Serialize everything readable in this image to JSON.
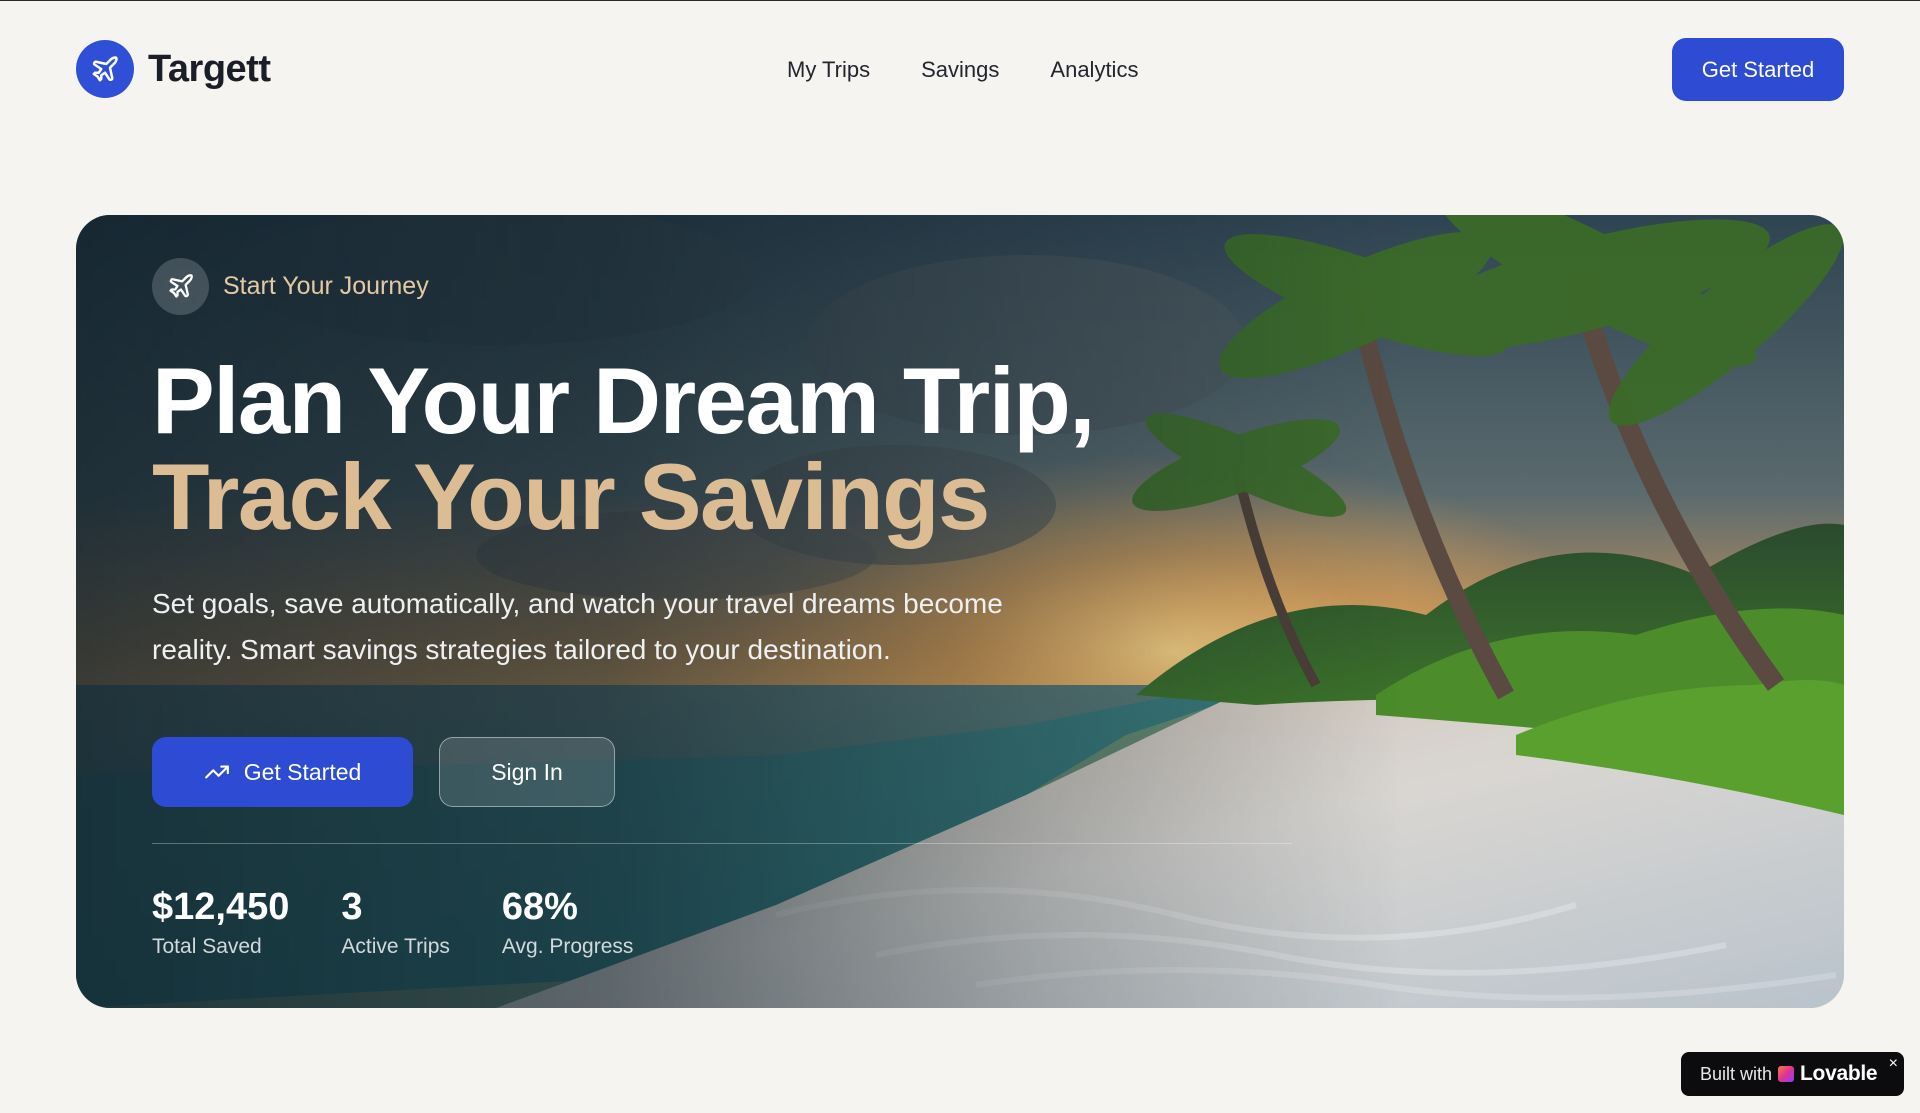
{
  "brand": {
    "name": "Targett"
  },
  "nav": [
    {
      "label": "My Trips"
    },
    {
      "label": "Savings"
    },
    {
      "label": "Analytics"
    }
  ],
  "header": {
    "cta_label": "Get Started"
  },
  "hero": {
    "badge_icon": "airplane-icon",
    "badge_text": "Start Your Journey",
    "title_line1": "Plan Your Dream Trip,",
    "title_line2": "Track Your Savings",
    "lede": "Set goals, save automatically, and watch your travel dreams become reality. Smart savings strategies tailored to your destination.",
    "primary_button": "Get Started",
    "primary_icon": "trending-up-icon",
    "secondary_button": "Sign In",
    "stats": [
      {
        "value": "$12,450",
        "label": "Total Saved"
      },
      {
        "value": "3",
        "label": "Active Trips"
      },
      {
        "value": "68%",
        "label": "Avg. Progress"
      }
    ]
  },
  "footer_badge": {
    "prefix": "Built with",
    "brand": "Lovable"
  },
  "colors": {
    "accent": "#2d4bd3",
    "highlight": "#dcbc92",
    "background": "#f6f4f1"
  }
}
